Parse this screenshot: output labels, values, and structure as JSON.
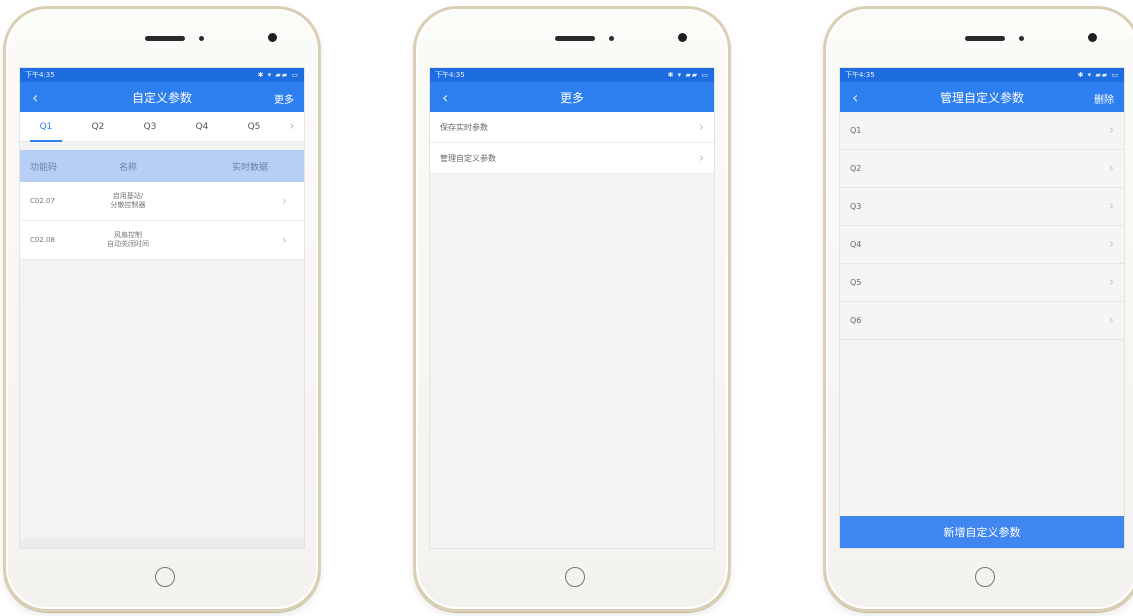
{
  "screens": [
    {
      "status": {
        "time": "下午4:35",
        "icons": "✱ ▾ ▰▰ ▭"
      },
      "nav": {
        "back": "‹",
        "title": "自定义参数",
        "action": "更多"
      },
      "tabs": [
        "Q1",
        "Q2",
        "Q3",
        "Q4",
        "Q5"
      ],
      "tab_more": "›",
      "table": {
        "headers": {
          "code": "功能码",
          "name": "名称",
          "data": "实时数据"
        },
        "rows": [
          {
            "code": "C02.07",
            "name_line1": "启用基站/",
            "name_line2": "分散控制器",
            "chev": "›"
          },
          {
            "code": "C02.08",
            "name_line1": "风扇控制",
            "name_line2": "自动关闭时间",
            "chev": "›"
          }
        ]
      }
    },
    {
      "status": {
        "time": "下午4:35",
        "icons": "✱ ▾ ▰▰ ▭"
      },
      "nav": {
        "back": "‹",
        "title": "更多"
      },
      "items": [
        {
          "label": "保存实时参数",
          "chev": "›"
        },
        {
          "label": "管理自定义参数",
          "chev": "›"
        }
      ]
    },
    {
      "status": {
        "time": "下午4:35",
        "icons": "✱ ▾ ▰▰ ▭"
      },
      "nav": {
        "back": "‹",
        "title": "管理自定义参数",
        "action": "删除"
      },
      "items": [
        {
          "label": "Q1",
          "chev": "›"
        },
        {
          "label": "Q2",
          "chev": "›"
        },
        {
          "label": "Q3",
          "chev": "›"
        },
        {
          "label": "Q4",
          "chev": "›"
        },
        {
          "label": "Q5",
          "chev": "›"
        },
        {
          "label": "Q6",
          "chev": "›"
        }
      ],
      "add_button": "新增自定义参数"
    }
  ],
  "colors": {
    "accent": "#2d7ff0",
    "statusbar": "#1e6de0",
    "table_header": "#b7cef5",
    "frame": "#d9cfb4"
  }
}
